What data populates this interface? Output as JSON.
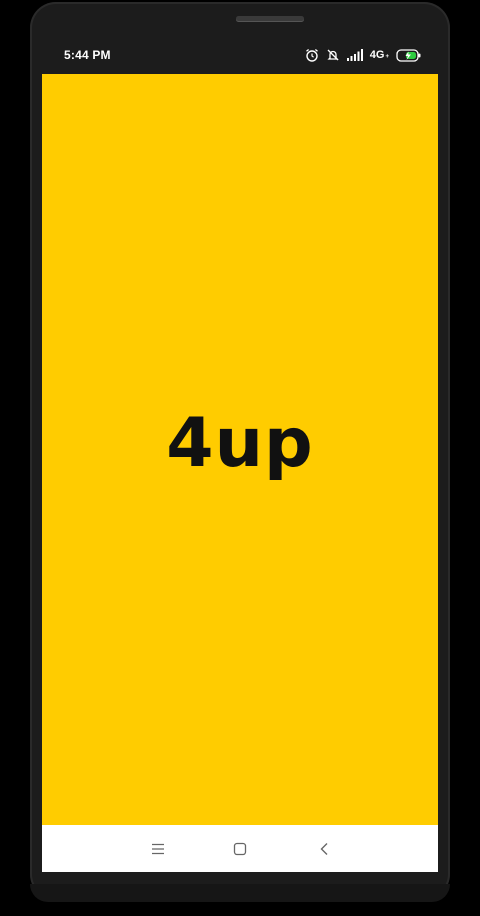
{
  "status_bar": {
    "time": "5:44 PM",
    "network": "4G",
    "network_sub": "+",
    "icons": [
      "alarm-icon",
      "silent-icon",
      "signal-icon",
      "battery-charging-icon"
    ]
  },
  "app": {
    "logo_text": "4up",
    "background_color": "#FFCC00"
  },
  "nav_bar": {
    "buttons": [
      "menu-icon",
      "home-icon",
      "back-icon"
    ]
  }
}
